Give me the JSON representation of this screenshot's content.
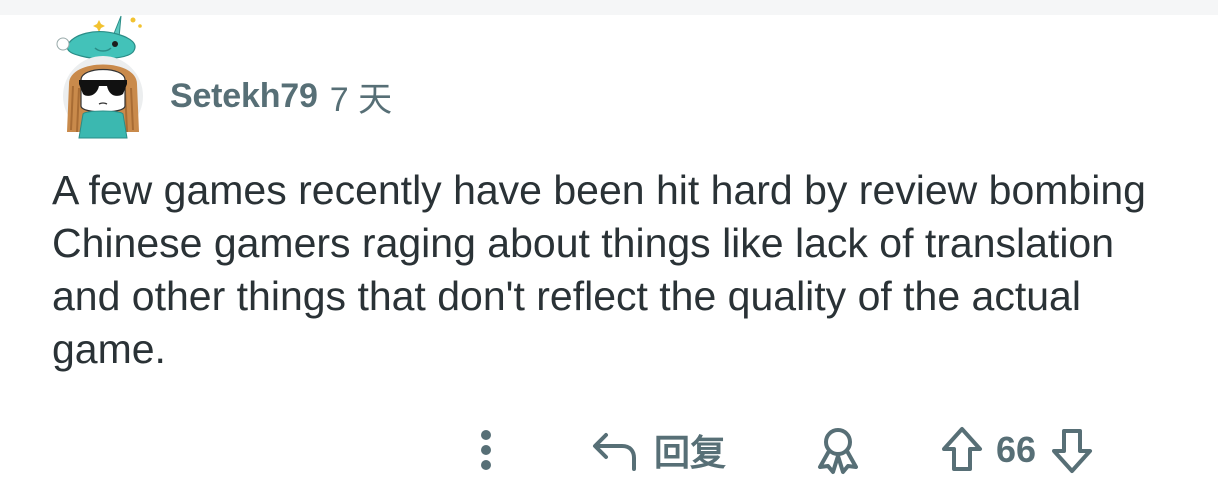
{
  "comment": {
    "username": "Setekh79",
    "age": "7 天",
    "body": "A few games recently have been hit hard by review bombing Chinese gamers raging about things like lack of translation and other things that don't reflect the quality of the actual game."
  },
  "actions": {
    "more_icon": "vertical-ellipsis-icon",
    "reply_icon": "reply-arrow-icon",
    "reply_label": "回复",
    "award_icon": "award-ribbon-icon",
    "upvote_icon": "upvote-arrow-icon",
    "downvote_icon": "downvote-arrow-icon",
    "score": "66"
  },
  "colors": {
    "meta_text": "#576f76",
    "body_text": "#2a3236",
    "top_strip": "#f5f6f7",
    "avatar_teal": "#3bb8b0"
  }
}
